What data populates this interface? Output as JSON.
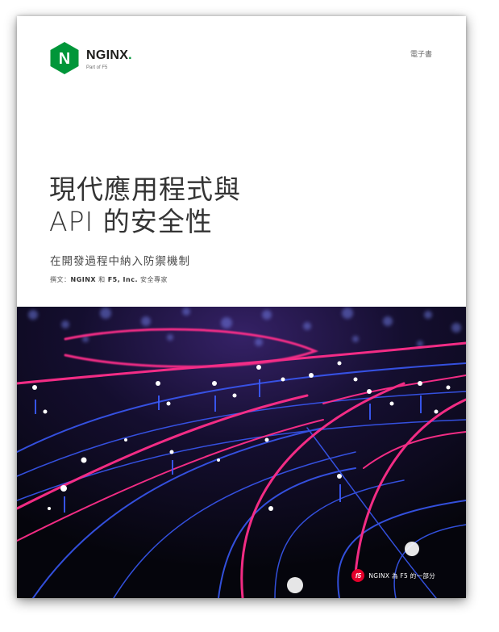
{
  "logo": {
    "brand": "NGINX",
    "letter": "N",
    "tagline": "Part of F5"
  },
  "doc_type": "電子書",
  "title": {
    "line1": "現代應用程式與",
    "line2": "API 的安全性"
  },
  "subtitle": "在開發過程中納入防禦機制",
  "author": {
    "prefix": "撰文：",
    "org1": "NGINX",
    "conj": " 和 ",
    "org2": "F5, Inc.",
    "suffix": " 安全專家"
  },
  "footer": {
    "f5_logo": "f5",
    "text": "NGINX 為 F5 的一部分"
  },
  "colors": {
    "nginx_green": "#009639",
    "f5_red": "#e4002b",
    "art_pink": "#ff2e8a",
    "art_blue": "#3b5cff"
  }
}
